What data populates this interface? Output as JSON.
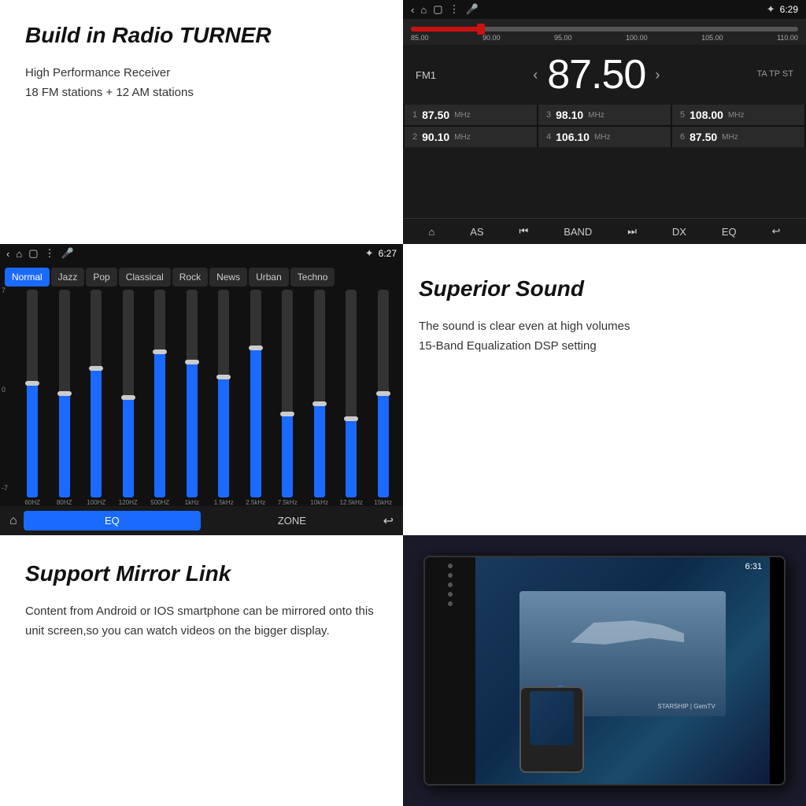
{
  "radio": {
    "section_title": "Build in Radio TURNER",
    "desc_line1": "High Performance Receiver",
    "desc_line2": "18 FM stations + 12 AM stations",
    "status_time": "6:29",
    "freq_labels": [
      "85.00",
      "90.00",
      "95.00",
      "100.00",
      "105.00",
      "110.00"
    ],
    "fm_label": "FM1",
    "fm_frequency": "87.50",
    "fm_ta_tp": "TA TP ST",
    "presets": [
      {
        "num": "1",
        "freq": "87.50",
        "unit": "MHz"
      },
      {
        "num": "3",
        "freq": "98.10",
        "unit": "MHz"
      },
      {
        "num": "5",
        "freq": "108.00",
        "unit": "MHz"
      },
      {
        "num": "2",
        "freq": "90.10",
        "unit": "MHz"
      },
      {
        "num": "4",
        "freq": "106.10",
        "unit": "MHz"
      },
      {
        "num": "6",
        "freq": "87.50",
        "unit": "MHz"
      }
    ],
    "controls": [
      "⌂",
      "AS",
      "⏮",
      "BAND",
      "⏭",
      "DX",
      "EQ",
      "↩"
    ]
  },
  "eq": {
    "status_time": "6:27",
    "tabs": [
      "Normal",
      "Jazz",
      "Pop",
      "Classical",
      "Rock",
      "News",
      "Urban",
      "Techno"
    ],
    "active_tab": "Normal",
    "y_labels": [
      "7",
      "0",
      "-7"
    ],
    "freq_labels": [
      "60HZ",
      "80HZ",
      "100HZ",
      "120HZ",
      "500HZ",
      "1kHz",
      "1.5kHz",
      "2.5kHz",
      "7.5kHz",
      "10kHz",
      "12.5kHz",
      "15kHz"
    ],
    "bar_heights_pct": [
      55,
      50,
      62,
      48,
      70,
      65,
      58,
      72,
      40,
      45,
      38,
      50
    ],
    "handle_positions_pct": [
      45,
      50,
      38,
      52,
      30,
      35,
      42,
      28,
      60,
      55,
      62,
      50
    ],
    "bottom_eq_label": "EQ",
    "bottom_zone_label": "ZONE",
    "section_title": "Superior Sound",
    "desc_line1": "The sound is clear even at high volumes",
    "desc_line2": "15-Band Equalization DSP setting"
  },
  "mirror": {
    "section_title": "Support Mirror Link",
    "desc": "Content from Android or IOS smartphone can be mirrored onto this unit screen,so you can watch videos on the  bigger display.",
    "unit_time": "6:31",
    "brand": "STARSHIP | GemTV"
  }
}
